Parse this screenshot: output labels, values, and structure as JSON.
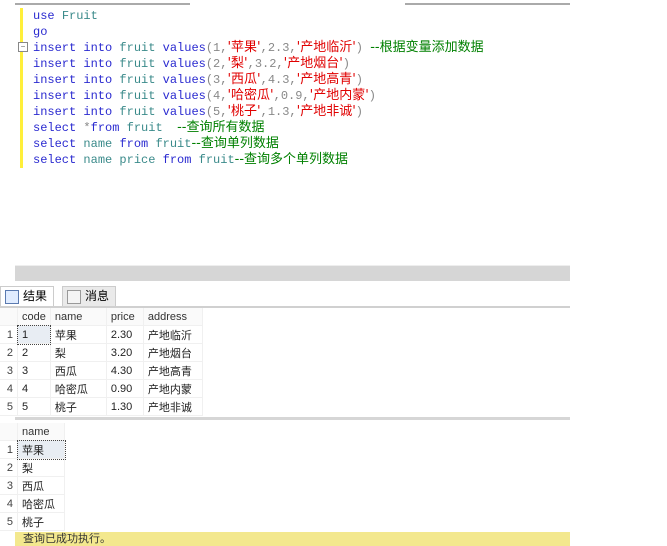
{
  "editor": {
    "lines": [
      [
        [
          "kw",
          "use "
        ],
        [
          "id",
          "Fruit"
        ]
      ],
      [
        [
          "kw",
          "go"
        ]
      ],
      [
        [
          "kw",
          "insert into "
        ],
        [
          "id",
          "fruit "
        ],
        [
          "kw",
          "values"
        ],
        [
          "gr",
          "(1,"
        ],
        [
          "str",
          "'苹果'"
        ],
        [
          "gr",
          ",2.3,"
        ],
        [
          "str",
          "'产地临沂'"
        ],
        [
          "gr",
          ") "
        ],
        [
          "cm",
          "--根据变量添加数据"
        ]
      ],
      [
        [
          "kw",
          "insert into "
        ],
        [
          "id",
          "fruit "
        ],
        [
          "kw",
          "values"
        ],
        [
          "gr",
          "(2,"
        ],
        [
          "str",
          "'梨'"
        ],
        [
          "gr",
          ",3.2,"
        ],
        [
          "str",
          "'产地烟台'"
        ],
        [
          "gr",
          ")"
        ]
      ],
      [
        [
          "kw",
          "insert into "
        ],
        [
          "id",
          "fruit "
        ],
        [
          "kw",
          "values"
        ],
        [
          "gr",
          "(3,"
        ],
        [
          "str",
          "'西瓜'"
        ],
        [
          "gr",
          ",4.3,"
        ],
        [
          "str",
          "'产地高青'"
        ],
        [
          "gr",
          ")"
        ]
      ],
      [
        [
          "kw",
          "insert into "
        ],
        [
          "id",
          "fruit "
        ],
        [
          "kw",
          "values"
        ],
        [
          "gr",
          "(4,"
        ],
        [
          "str",
          "'哈密瓜'"
        ],
        [
          "gr",
          ",0.9,"
        ],
        [
          "str",
          "'产地内蒙'"
        ],
        [
          "gr",
          ")"
        ]
      ],
      [
        [
          "kw",
          "insert into "
        ],
        [
          "id",
          "fruit "
        ],
        [
          "kw",
          "values"
        ],
        [
          "gr",
          "(5,"
        ],
        [
          "str",
          "'桃子'"
        ],
        [
          "gr",
          ",1.3,"
        ],
        [
          "str",
          "'产地非诚'"
        ],
        [
          "gr",
          ")"
        ]
      ],
      [
        [
          "kw",
          "select "
        ],
        [
          "gr",
          "*"
        ],
        [
          "kw",
          "from "
        ],
        [
          "id",
          "fruit  "
        ],
        [
          "cm",
          "--查询所有数据"
        ]
      ],
      [
        [
          "kw",
          "select "
        ],
        [
          "id",
          "name "
        ],
        [
          "kw",
          "from "
        ],
        [
          "id",
          "fruit"
        ],
        [
          "cm",
          "--查询单列数据"
        ]
      ],
      [
        [
          "kw",
          "select "
        ],
        [
          "id",
          "name price "
        ],
        [
          "kw",
          "from "
        ],
        [
          "id",
          "fruit"
        ],
        [
          "cm",
          "--查询多个单列数据"
        ]
      ]
    ]
  },
  "tabs": {
    "results": "结果",
    "messages": "消息"
  },
  "grid1": {
    "headers": [
      "code",
      "name",
      "price",
      "address"
    ],
    "rows": [
      [
        "1",
        "苹果",
        "2.30",
        "产地临沂"
      ],
      [
        "2",
        "梨",
        "3.20",
        "产地烟台"
      ],
      [
        "3",
        "西瓜",
        "4.30",
        "产地高青"
      ],
      [
        "4",
        "哈密瓜",
        "0.90",
        "产地内蒙"
      ],
      [
        "5",
        "桃子",
        "1.30",
        "产地非诚"
      ]
    ],
    "row_numbers": [
      "1",
      "2",
      "3",
      "4",
      "5"
    ]
  },
  "grid2": {
    "headers": [
      "name"
    ],
    "rows": [
      [
        "苹果"
      ],
      [
        "梨"
      ],
      [
        "西瓜"
      ],
      [
        "哈密瓜"
      ],
      [
        "桃子"
      ]
    ],
    "row_numbers": [
      "1",
      "2",
      "3",
      "4",
      "5"
    ]
  },
  "status": "查询已成功执行。"
}
